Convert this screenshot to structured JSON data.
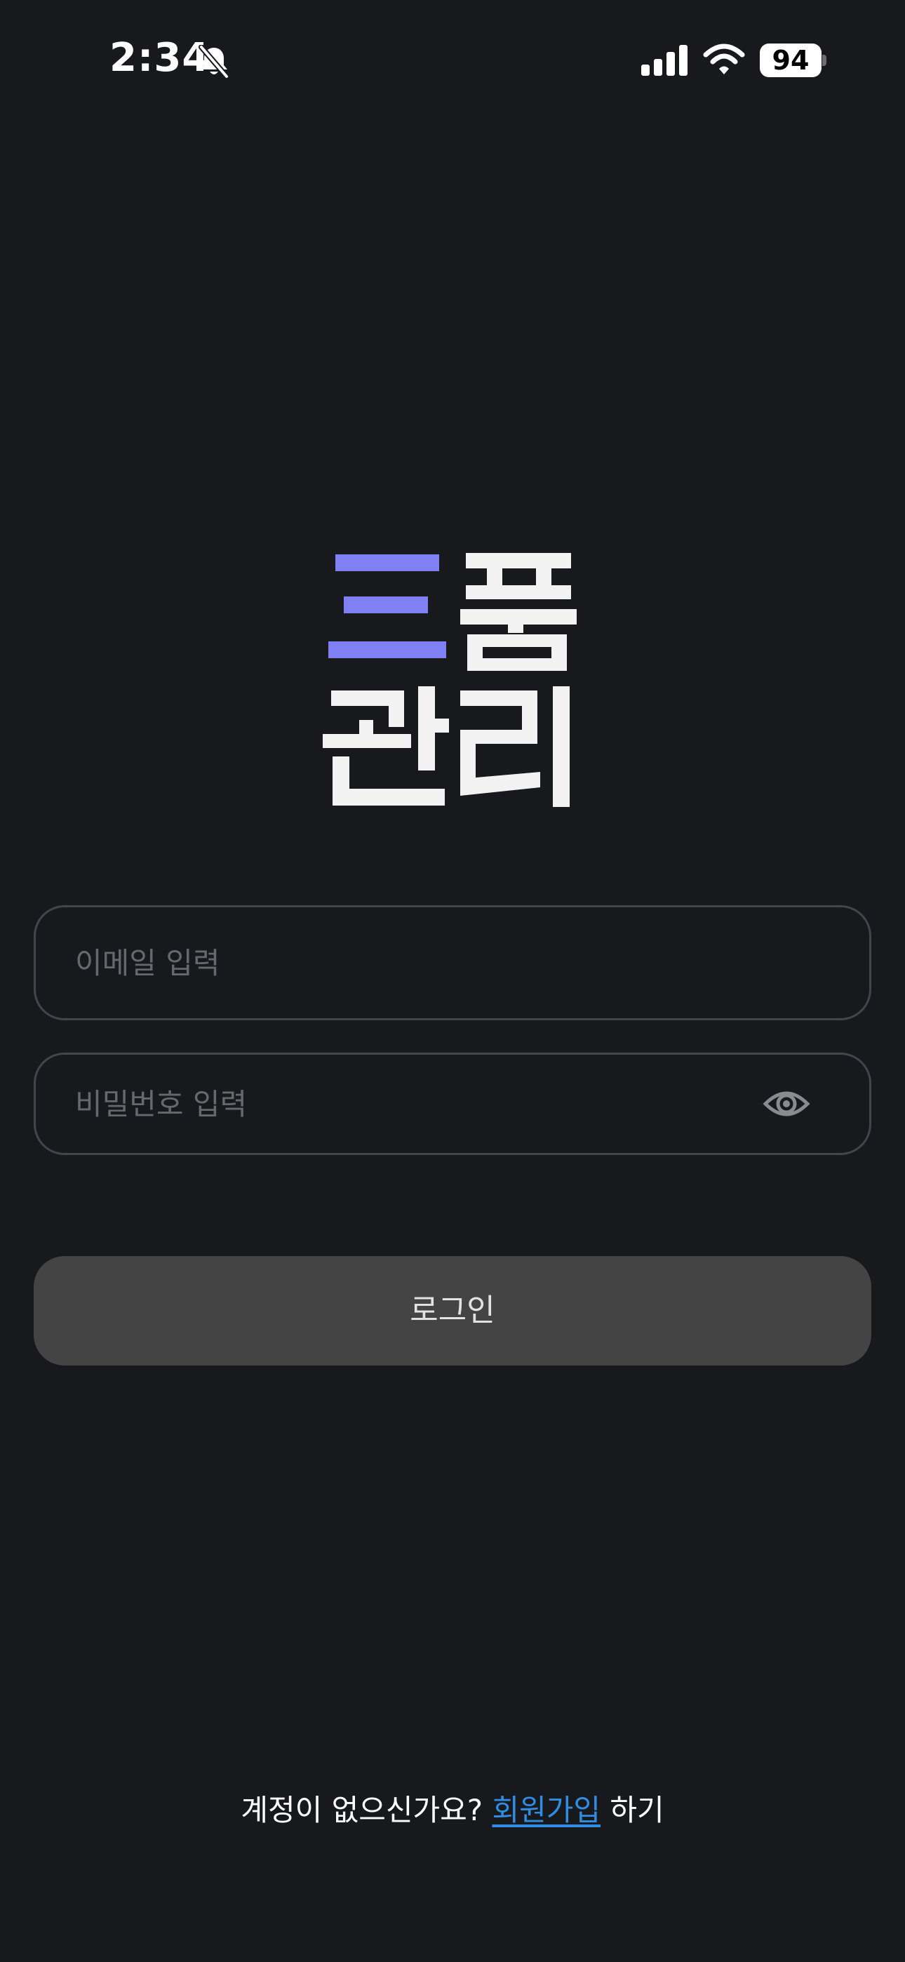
{
  "status_bar": {
    "time": "2:34",
    "battery": "94",
    "icons": [
      "bell-slash-icon",
      "signal-icon",
      "wifi-icon",
      "battery-icon"
    ]
  },
  "logo": {
    "line1": "三품",
    "line2": "관리",
    "accent_color": "#8080f5",
    "text_color": "#f2f2f2"
  },
  "form": {
    "email_placeholder": "이메일 입력",
    "email_value": "",
    "password_placeholder": "비밀번호 입력",
    "password_value": "",
    "password_toggle_icon": "eye-icon",
    "login_label": "로그인"
  },
  "footer": {
    "prompt": "계정이 없으신가요?",
    "signup_link": "회원가입",
    "suffix": "하기",
    "link_color": "#2f8de4"
  }
}
